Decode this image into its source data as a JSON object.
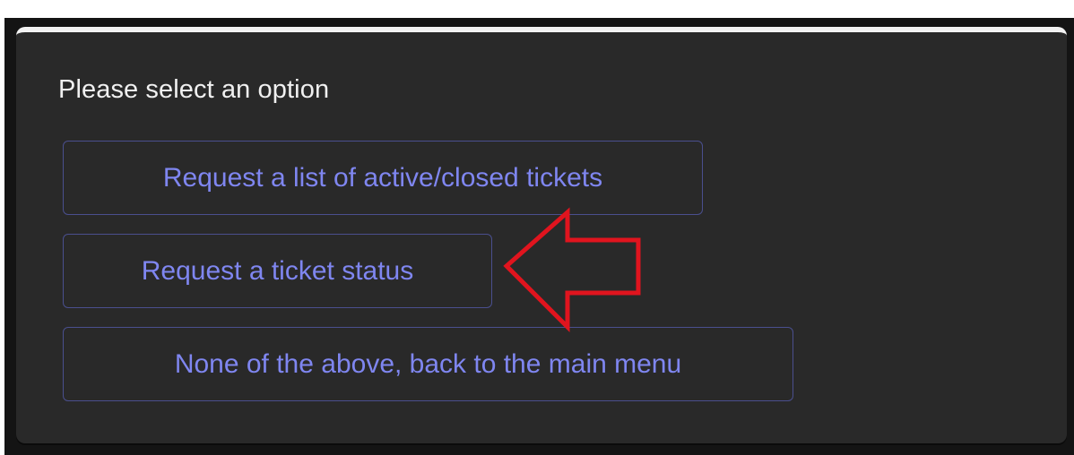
{
  "dialog": {
    "prompt": "Please select an option",
    "options": [
      {
        "label": "Request a list of active/closed tickets"
      },
      {
        "label": "Request a ticket status"
      },
      {
        "label": "None of the above, back to the main menu"
      }
    ]
  },
  "annotation": {
    "type": "arrow",
    "target": "Request a ticket status",
    "color": "#e0141e"
  },
  "colors": {
    "card_background": "#292929",
    "button_text": "#7f86f0",
    "button_border": "#4a4f8e",
    "prompt_text": "#f0f0f0"
  }
}
